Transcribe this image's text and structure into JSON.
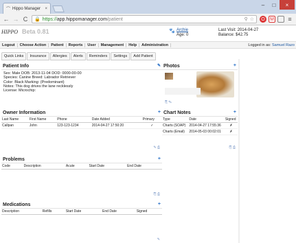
{
  "browser": {
    "tab_title": "Hippo Manager",
    "tab_close": "×",
    "url_scheme": "https://",
    "url_host": "app.hippomanager.com",
    "url_path": "/patient",
    "back": "←",
    "forward": "→",
    "reload": "C",
    "lock": "🔒",
    "menu": "≡",
    "minimize": "–",
    "maximize": "□",
    "close": "×"
  },
  "header": {
    "logo_text": "HIPPO",
    "beta": "Beta 0.81",
    "patient_name": "Archie",
    "patient_age": "Age: 0",
    "last_visit": "Last Visit: 2014-04-27",
    "balance": "Balance: $42.75"
  },
  "menu": {
    "items": [
      "Logout",
      "Choose Action",
      "Patient",
      "Reports",
      "User",
      "Management",
      "Help",
      "Administration"
    ],
    "logged_in_prefix": "Logged in as:",
    "logged_in_user": "Samuel Razo"
  },
  "subtabs": [
    "Quick Links",
    "Insurance",
    "Allergies",
    "Alerts",
    "Reminders",
    "Settings",
    "Add Patient"
  ],
  "patient_info": {
    "title": "Patient Info",
    "line1": "Sex: Male   DOB: 2013-11-04   DOD: 0000-00-00",
    "line2": "Species: Canine   Breed: Labrador Retriever",
    "line3": "Color: Black   Marking: (Predominant)",
    "line4": "Notes: This dog drives the lane recklessly",
    "line5": "License:   Microchip:"
  },
  "owner": {
    "title": "Owner Information",
    "headers": [
      "Last Name",
      "First Name",
      "Phone",
      "Date Added",
      "Primary"
    ],
    "rows": [
      [
        "Callpan",
        "John",
        "123-123-1234",
        "2014-04-27 17:50:20",
        "✓"
      ]
    ]
  },
  "problems": {
    "title": "Problems",
    "headers": [
      "Code",
      "Description",
      "Acute",
      "Start Date",
      "End Date"
    ]
  },
  "medications": {
    "title": "Medications",
    "headers": [
      "Description",
      "Refills",
      "Start Date",
      "End Date",
      "Signed"
    ]
  },
  "photos": {
    "title": "Photos"
  },
  "chart_notes": {
    "title": "Chart Notes",
    "headers": [
      "Type",
      "Date",
      "Signed"
    ],
    "rows": [
      [
        "Charts (SOAP)",
        "2014-04-27 17:55:36",
        "✗"
      ],
      [
        "Charts (Email)",
        "2014-05-03 00:02:01",
        "✗"
      ]
    ]
  },
  "icons": {
    "add": "+",
    "edit": "✎",
    "print": "⎙"
  }
}
